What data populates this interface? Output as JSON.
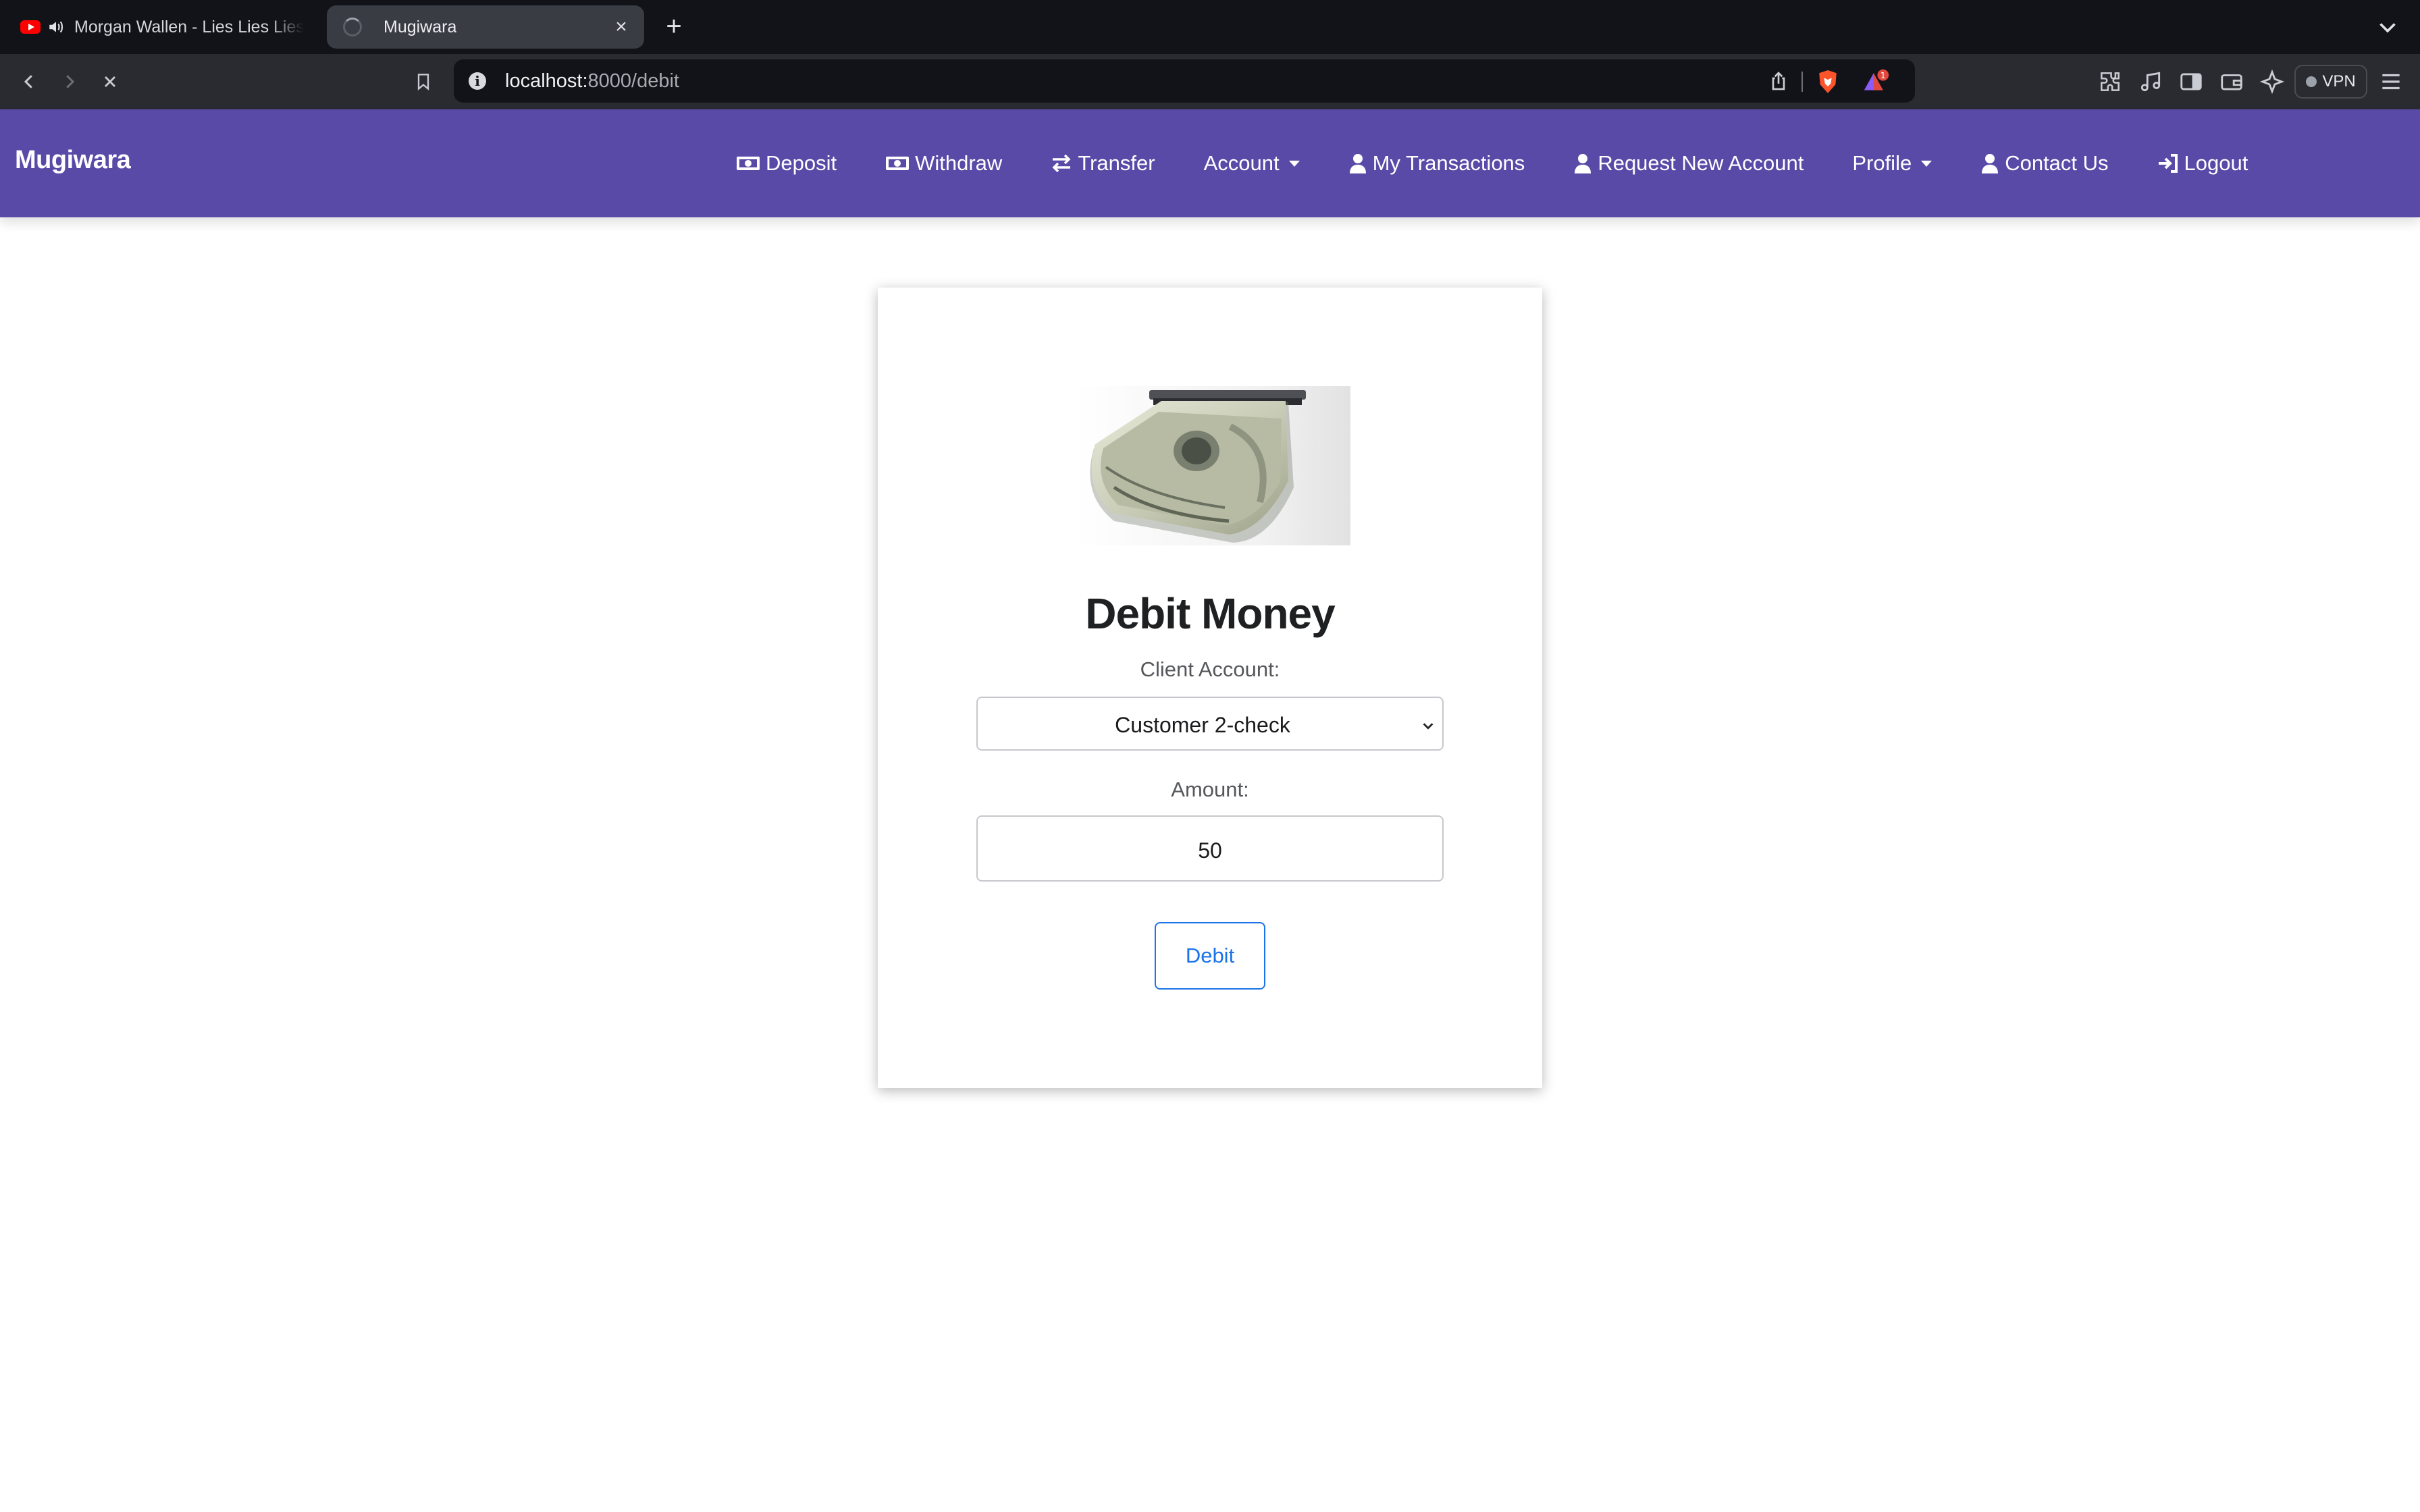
{
  "browser": {
    "tabs": [
      {
        "title": "Morgan Wallen - Lies Lies Lies",
        "icon": "youtube-icon",
        "audio_icon": "speaker-icon",
        "active": false
      },
      {
        "title": "Mugiwara",
        "icon": "loading-spinner-icon",
        "active": true
      }
    ],
    "url": {
      "host": "localhost:",
      "path": "8000/debit"
    },
    "vpn_label": "VPN",
    "rewards_count": "1"
  },
  "navbar": {
    "brand": "Mugiwara",
    "items": [
      {
        "label": "Deposit",
        "icon": "money-bill-icon"
      },
      {
        "label": "Withdraw",
        "icon": "money-bill-icon"
      },
      {
        "label": "Transfer",
        "icon": "exchange-arrows-icon"
      },
      {
        "label": "Account",
        "dropdown": true
      },
      {
        "label": "My Transactions",
        "icon": "user-icon"
      },
      {
        "label": "Request New Account",
        "icon": "user-icon"
      },
      {
        "label": "Profile",
        "dropdown": true
      },
      {
        "label": "Contact Us",
        "icon": "user-icon"
      },
      {
        "label": "Logout",
        "icon": "sign-out-icon"
      }
    ],
    "accent": "#5a4aa8"
  },
  "form": {
    "title": "Debit Money",
    "client_account_label": "Client Account:",
    "client_account_value": "Customer 2-check",
    "amount_label": "Amount:",
    "amount_value": "50",
    "submit_label": "Debit",
    "button_color": "#1a73e8"
  }
}
